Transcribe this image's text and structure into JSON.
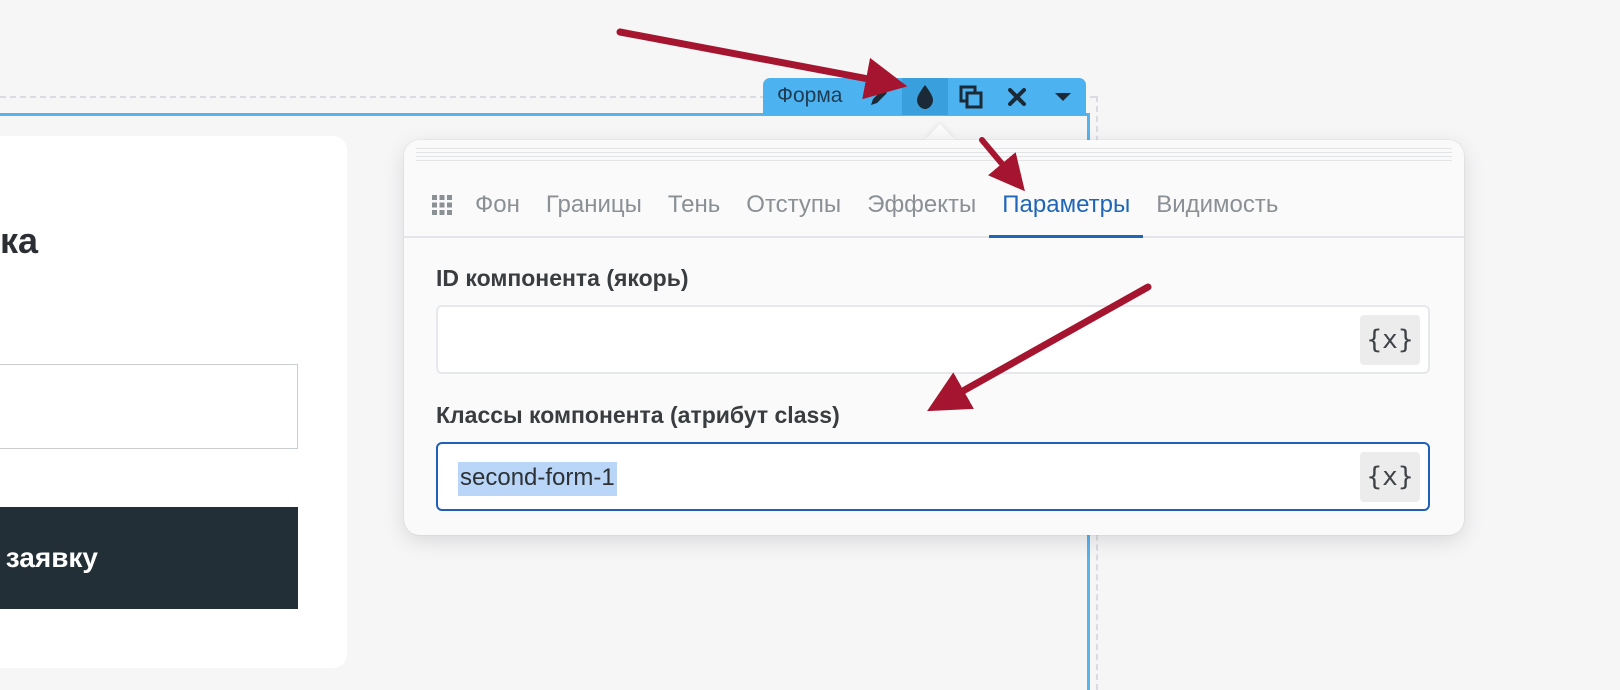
{
  "canvas": {
    "heading_fragment": "ка",
    "submit_fragment": "заявку"
  },
  "component_toolbar": {
    "label": "Форма",
    "buttons": [
      {
        "name": "edit",
        "icon": "pencil-icon"
      },
      {
        "name": "style",
        "icon": "drop-icon",
        "active": true
      },
      {
        "name": "duplicate",
        "icon": "copy-icon"
      },
      {
        "name": "delete",
        "icon": "close-icon"
      },
      {
        "name": "more",
        "icon": "caret-down-icon"
      }
    ]
  },
  "popover": {
    "tabs": [
      {
        "label": "Фон"
      },
      {
        "label": "Границы"
      },
      {
        "label": "Тень"
      },
      {
        "label": "Отступы"
      },
      {
        "label": "Эффекты"
      },
      {
        "label": "Параметры",
        "active": true
      },
      {
        "label": "Видимость"
      }
    ],
    "fields": {
      "id": {
        "label": "ID компонента (якорь)",
        "value": "",
        "var_button": "{x}"
      },
      "classes": {
        "label": "Классы компонента (атрибут class)",
        "value": "second-form-1",
        "var_button": "{x}"
      }
    }
  },
  "colors": {
    "accent": "#4db2f0",
    "active_tab": "#1f66b8",
    "focus_border": "#1f5fba",
    "arrow": "#a6152f",
    "submit_bg": "#232f37"
  }
}
